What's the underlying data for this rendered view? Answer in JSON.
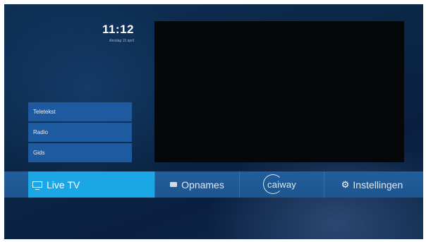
{
  "clock": {
    "time": "11:12",
    "date": "dinsdag 15 april"
  },
  "side_menu": {
    "items": [
      {
        "label": "Teletekst"
      },
      {
        "label": "Radio"
      },
      {
        "label": "Gids"
      }
    ]
  },
  "menu_bar": {
    "items": [
      {
        "label": "Live TV",
        "icon": "tv-icon",
        "selected": true
      },
      {
        "label": "Opnames",
        "icon": "record-icon",
        "selected": false
      },
      {
        "label": "caiway",
        "icon": "caiway-logo",
        "selected": false
      },
      {
        "label": "Instellingen",
        "icon": "gear-icon",
        "selected": false
      }
    ]
  },
  "colors": {
    "background": "#0b2746",
    "menu_bar": "#215e9d",
    "selected": "#1ba7e6",
    "side_item": "#1d5a9f",
    "video": "#050708"
  }
}
